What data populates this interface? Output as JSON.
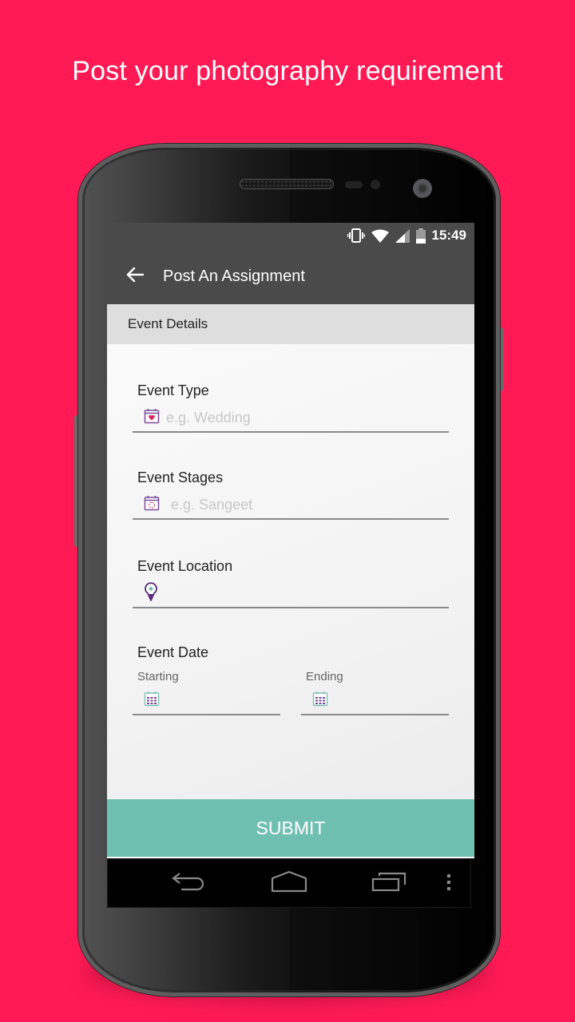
{
  "headline": "Post your photography requirement",
  "status_bar": {
    "time": "15:49",
    "icons": [
      "vibrate-icon",
      "wifi-icon",
      "cell-signal-icon",
      "battery-icon"
    ]
  },
  "app_bar": {
    "back_icon": "arrow-left-icon",
    "title": "Post An Assignment"
  },
  "section_header": "Event Details",
  "form": {
    "event_type": {
      "label": "Event Type",
      "icon": "calendar-heart-icon",
      "placeholder": "e.g. Wedding",
      "value": ""
    },
    "event_stages": {
      "label": "Event Stages",
      "icon": "calendar-stages-icon",
      "placeholder": "e.g. Sangeet",
      "value": ""
    },
    "event_location": {
      "label": "Event Location",
      "icon": "map-pin-icon",
      "placeholder": "",
      "value": ""
    },
    "event_date": {
      "label": "Event Date",
      "starting": {
        "label": "Starting",
        "icon": "calendar-grid-icon",
        "value": ""
      },
      "ending": {
        "label": "Ending",
        "icon": "calendar-grid-icon",
        "value": ""
      }
    }
  },
  "submit_label": "SUBMIT",
  "nav_bar": {
    "buttons": [
      "back-nav-icon",
      "home-nav-icon",
      "recents-nav-icon",
      "overflow-menu-icon"
    ]
  },
  "colors": {
    "background": "#ff1a55",
    "app_bar": "#4a4a4a",
    "section_header": "#dedede",
    "submit": "#6fc0b1",
    "icon_purple": "#7a4a9a",
    "icon_heart": "#e0245e"
  }
}
